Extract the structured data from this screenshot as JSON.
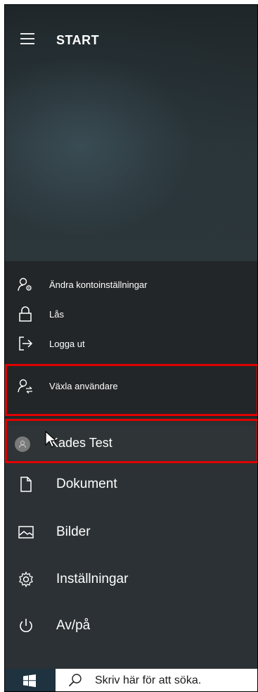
{
  "start_menu": {
    "title": "START",
    "account_menu": [
      {
        "label": "Ändra kontoinställningar",
        "icon": "user-settings-icon"
      },
      {
        "label": "Lås",
        "icon": "lock-icon"
      },
      {
        "label": "Logga ut",
        "icon": "sign-out-icon"
      },
      {
        "label": "Växla användare",
        "icon": "switch-user-icon"
      }
    ],
    "user": {
      "name": "Kades Test"
    },
    "nav": [
      {
        "label": "Dokument",
        "icon": "document-icon"
      },
      {
        "label": "Bilder",
        "icon": "pictures-icon"
      },
      {
        "label": "Inställningar",
        "icon": "gear-icon"
      },
      {
        "label": "Av/på",
        "icon": "power-icon"
      }
    ]
  },
  "taskbar": {
    "search_placeholder": "Skriv här för att söka."
  },
  "colors": {
    "highlight": "#e00000",
    "panel": "#2b3134"
  }
}
